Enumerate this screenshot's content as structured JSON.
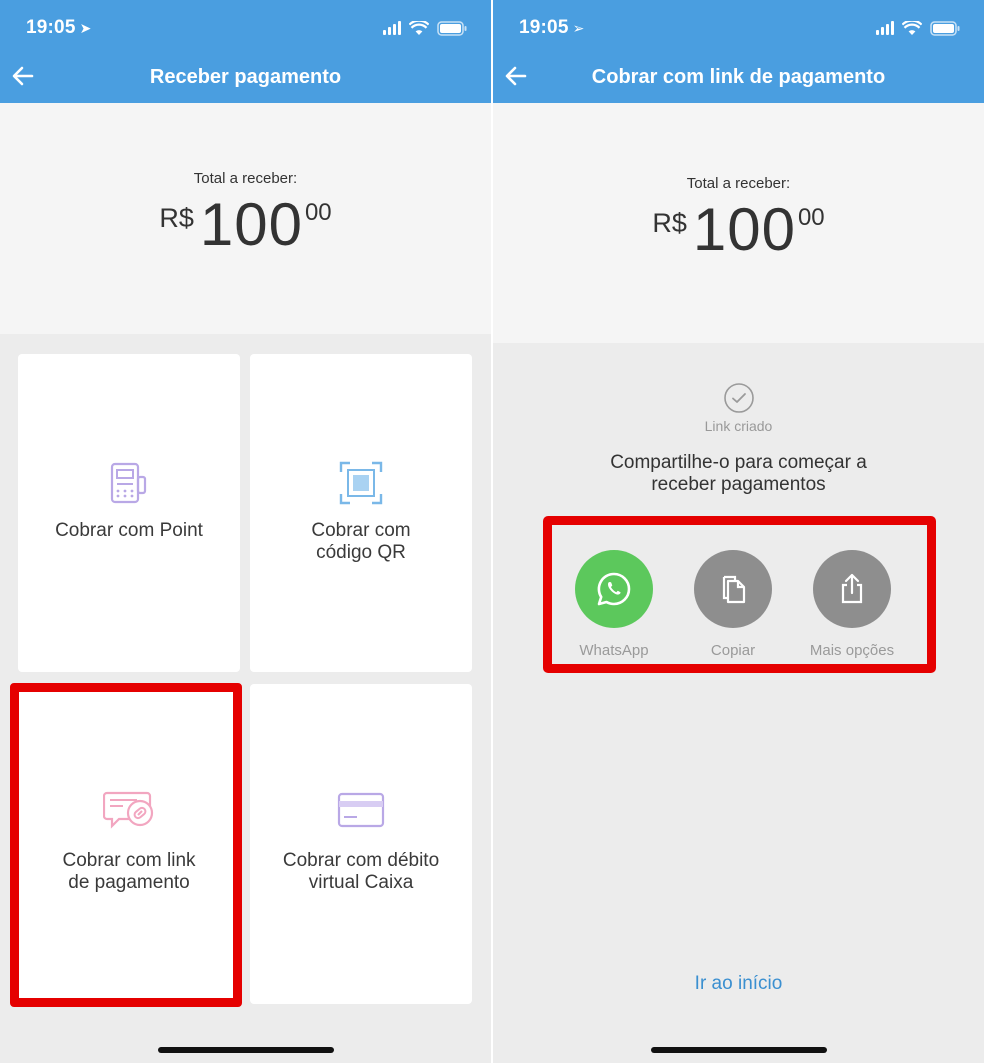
{
  "left": {
    "status": {
      "time": "19:05"
    },
    "header": {
      "title": "Receber pagamento"
    },
    "total": {
      "label": "Total a receber:",
      "currency": "R$",
      "integer": "100",
      "cents": "00"
    },
    "options": [
      {
        "label_line1": "Cobrar com Point",
        "label_line2": "",
        "icon": "point-device-icon"
      },
      {
        "label_line1": "Cobrar com",
        "label_line2": "código QR",
        "icon": "qr-code-icon"
      },
      {
        "label_line1": "Cobrar com link",
        "label_line2": "de pagamento",
        "icon": "payment-link-icon"
      },
      {
        "label_line1": "Cobrar com débito",
        "label_line2": "virtual Caixa",
        "icon": "debit-card-icon"
      }
    ]
  },
  "right": {
    "status": {
      "time": "19:05"
    },
    "header": {
      "title": "Cobrar com link de pagamento"
    },
    "total": {
      "label": "Total a receber:",
      "currency": "R$",
      "integer": "100",
      "cents": "00"
    },
    "link_status": "Link criado",
    "share_message_line1": "Compartilhe-o para começar a",
    "share_message_line2": "receber pagamentos",
    "share_buttons": [
      {
        "label": "WhatsApp",
        "icon": "whatsapp-icon",
        "color": "#5cc85c"
      },
      {
        "label": "Copiar",
        "icon": "copy-icon",
        "color": "#8e8e8e"
      },
      {
        "label": "Mais opções",
        "icon": "share-icon",
        "color": "#8e8e8e"
      }
    ],
    "home_link": "Ir ao início"
  },
  "colors": {
    "header": "#4a9ee0",
    "highlight": "#e50000",
    "link": "#3a8fd0"
  }
}
